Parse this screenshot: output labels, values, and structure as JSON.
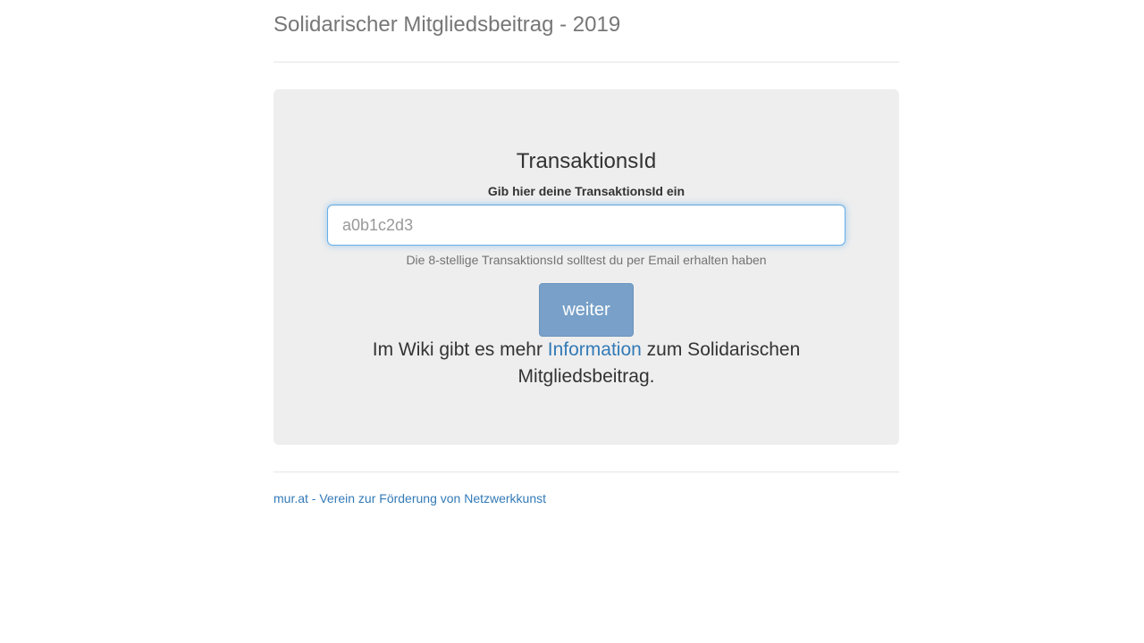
{
  "header": {
    "title": "Solidarischer Mitgliedsbeitrag - 2019"
  },
  "form": {
    "heading": "TransaktionsId",
    "label": "Gib hier deine TransaktionsId ein",
    "input_placeholder": "a0b1c2d3",
    "input_value": "",
    "help_text": "Die 8-stellige TransaktionsId solltest du per Email erhalten haben",
    "submit_label": "weiter"
  },
  "info": {
    "prefix": "Im Wiki gibt es mehr ",
    "link_text": "Information",
    "suffix": " zum Solidarischen Mitgliedsbeitrag."
  },
  "footer": {
    "link_text": "mur.at - Verein zur Förderung von Netzwerkkunst"
  },
  "colors": {
    "link": "#337ab7",
    "button": "#78a0c8",
    "panel": "#eeeeee",
    "title": "#777777"
  }
}
